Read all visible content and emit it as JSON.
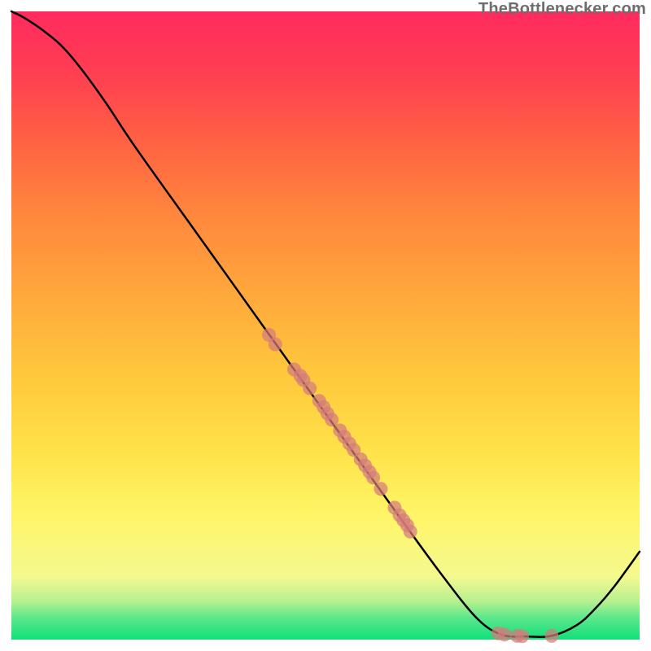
{
  "watermark": "TheBottlenecker.com",
  "chart_data": {
    "type": "line",
    "title": "",
    "xlabel": "",
    "ylabel": "",
    "xlim": [
      0,
      100
    ],
    "ylim": [
      0,
      100
    ],
    "grid": false,
    "series": [
      {
        "name": "curve",
        "points": [
          {
            "x": 0.0,
            "y": 100.0
          },
          {
            "x": 2.0,
            "y": 99.0
          },
          {
            "x": 5.0,
            "y": 97.0
          },
          {
            "x": 8.0,
            "y": 94.5
          },
          {
            "x": 11.0,
            "y": 91.0
          },
          {
            "x": 15.0,
            "y": 85.5
          },
          {
            "x": 20.0,
            "y": 78.0
          },
          {
            "x": 30.0,
            "y": 64.0
          },
          {
            "x": 40.0,
            "y": 50.0
          },
          {
            "x": 50.0,
            "y": 36.0
          },
          {
            "x": 60.0,
            "y": 22.0
          },
          {
            "x": 68.0,
            "y": 11.0
          },
          {
            "x": 74.0,
            "y": 3.5
          },
          {
            "x": 78.0,
            "y": 0.8
          },
          {
            "x": 82.0,
            "y": 0.5
          },
          {
            "x": 86.0,
            "y": 0.6
          },
          {
            "x": 90.0,
            "y": 2.3
          },
          {
            "x": 93.0,
            "y": 5.0
          },
          {
            "x": 96.0,
            "y": 8.5
          },
          {
            "x": 100.0,
            "y": 14.0
          }
        ]
      }
    ],
    "scatter": {
      "name": "points",
      "values": [
        {
          "x": 41.0,
          "y": 48.5
        },
        {
          "x": 42.0,
          "y": 47.0
        },
        {
          "x": 45.0,
          "y": 43.0
        },
        {
          "x": 46.0,
          "y": 42.0
        },
        {
          "x": 46.5,
          "y": 41.3
        },
        {
          "x": 47.5,
          "y": 40.0
        },
        {
          "x": 49.0,
          "y": 38.0
        },
        {
          "x": 49.7,
          "y": 37.0
        },
        {
          "x": 50.3,
          "y": 36.0
        },
        {
          "x": 51.0,
          "y": 35.0
        },
        {
          "x": 52.3,
          "y": 33.3
        },
        {
          "x": 53.0,
          "y": 32.3
        },
        {
          "x": 53.8,
          "y": 31.2
        },
        {
          "x": 54.5,
          "y": 30.2
        },
        {
          "x": 55.6,
          "y": 28.7
        },
        {
          "x": 56.3,
          "y": 27.7
        },
        {
          "x": 57.0,
          "y": 26.7
        },
        {
          "x": 57.6,
          "y": 25.8
        },
        {
          "x": 58.8,
          "y": 24.0
        },
        {
          "x": 61.0,
          "y": 21.0
        },
        {
          "x": 61.8,
          "y": 19.8
        },
        {
          "x": 62.4,
          "y": 19.0
        },
        {
          "x": 63.0,
          "y": 18.2
        },
        {
          "x": 63.5,
          "y": 17.2
        },
        {
          "x": 77.5,
          "y": 1.0
        },
        {
          "x": 78.5,
          "y": 0.8
        },
        {
          "x": 80.5,
          "y": 0.6
        },
        {
          "x": 81.3,
          "y": 0.55
        },
        {
          "x": 86.0,
          "y": 0.6
        }
      ]
    },
    "minimum": {
      "x": 82.0,
      "y": 0.5
    }
  }
}
